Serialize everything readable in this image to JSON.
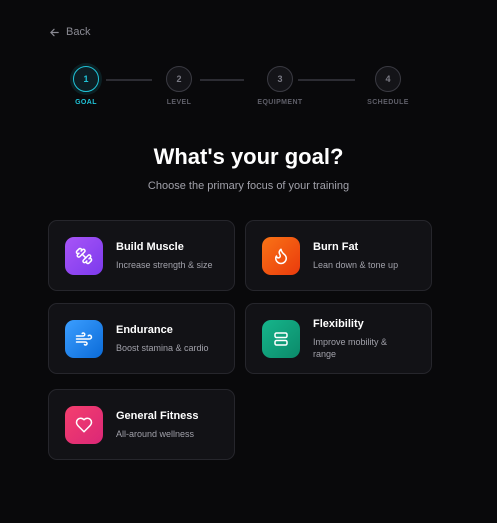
{
  "nav": {
    "back_label": "Back"
  },
  "steps": [
    {
      "number": "1",
      "label": "GOAL"
    },
    {
      "number": "2",
      "label": "LEVEL"
    },
    {
      "number": "3",
      "label": "EQUIPMENT"
    },
    {
      "number": "4",
      "label": "SCHEDULE"
    }
  ],
  "header": {
    "title": "What's your goal?",
    "subtitle": "Choose the primary focus of your training"
  },
  "goals": [
    {
      "title": "Build Muscle",
      "desc": "Increase strength & size",
      "icon": "dumbbell-icon",
      "colors": [
        "#a855f7",
        "#7c3aed"
      ]
    },
    {
      "title": "Burn Fat",
      "desc": "Lean down & tone up",
      "icon": "flame-icon",
      "colors": [
        "#f97316",
        "#ea3a0c"
      ]
    },
    {
      "title": "Endurance",
      "desc": "Boost stamina & cardio",
      "icon": "wind-icon",
      "colors": [
        "#3b9eff",
        "#0b6bd8"
      ]
    },
    {
      "title": "Flexibility",
      "desc": "Improve mobility & range",
      "icon": "stretch-icon",
      "colors": [
        "#16b58b",
        "#0b8a6a"
      ]
    },
    {
      "title": "General Fitness",
      "desc": "All-around wellness",
      "icon": "heart-icon",
      "colors": [
        "#f43f6e",
        "#db2777"
      ]
    }
  ],
  "accent_color": "#20c3d8"
}
